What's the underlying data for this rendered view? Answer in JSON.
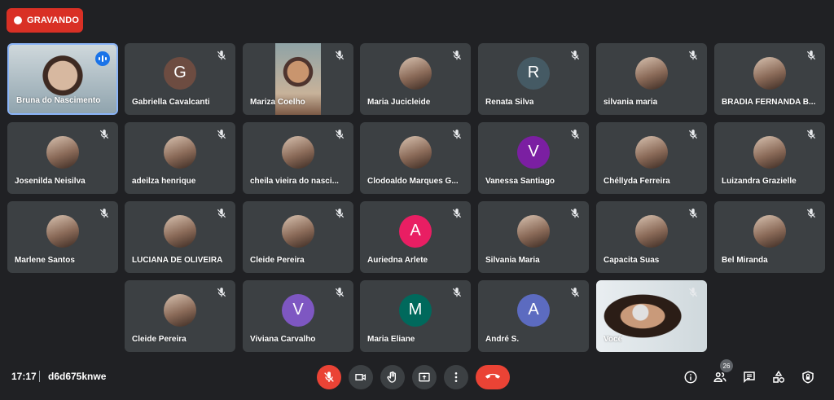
{
  "recording": {
    "label": "GRAVANDO"
  },
  "participants": [
    {
      "name": "Bruna do Nascimento",
      "kind": "video",
      "speaking": true
    },
    {
      "name": "Gabriella Cavalcanti",
      "kind": "letter",
      "initial": "G",
      "color": "#6d4c41"
    },
    {
      "name": "Mariza Coelho",
      "kind": "video"
    },
    {
      "name": "Maria Jucicleide",
      "kind": "photo"
    },
    {
      "name": "Renata Silva",
      "kind": "letter",
      "initial": "R",
      "color": "#455a64"
    },
    {
      "name": "silvania maria",
      "kind": "photo"
    },
    {
      "name": "BRADIA FERNANDA B...",
      "kind": "photo"
    },
    {
      "name": "Josenilda Neisilva",
      "kind": "photo"
    },
    {
      "name": "adeilza henrique",
      "kind": "photo"
    },
    {
      "name": "cheila vieira do nasci...",
      "kind": "photo"
    },
    {
      "name": "Clodoaldo Marques G...",
      "kind": "photo"
    },
    {
      "name": "Vanessa Santiago",
      "kind": "letter",
      "initial": "V",
      "color": "#7b1fa2"
    },
    {
      "name": "Chéllyda Ferreira",
      "kind": "photo"
    },
    {
      "name": "Luizandra Grazielle",
      "kind": "photo"
    },
    {
      "name": "Marlene Santos",
      "kind": "photo"
    },
    {
      "name": "LUCIANA DE OLIVEIRA",
      "kind": "photo"
    },
    {
      "name": "Cleide Pereira",
      "kind": "photo"
    },
    {
      "name": "Auriedna Arlete",
      "kind": "letter",
      "initial": "A",
      "color": "#e91e63"
    },
    {
      "name": "Silvania Maria",
      "kind": "photo"
    },
    {
      "name": "Capacita Suas",
      "kind": "photo"
    },
    {
      "name": "Bel Miranda",
      "kind": "photo"
    },
    {
      "name": "Cleide Pereira",
      "kind": "photo"
    },
    {
      "name": "Viviana Carvalho",
      "kind": "letter",
      "initial": "V",
      "color": "#7e57c2"
    },
    {
      "name": "Maria Eliane",
      "kind": "letter",
      "initial": "M",
      "color": "#00695c"
    },
    {
      "name": "André S.",
      "kind": "letter",
      "initial": "A",
      "color": "#5c6bc0"
    },
    {
      "name": "Você",
      "kind": "video"
    }
  ],
  "bottom": {
    "time": "17:17",
    "meeting_code": "d6d675knwe",
    "participant_count": "26",
    "controls": [
      "mic-off-icon",
      "camera-icon",
      "raise-hand-icon",
      "present-icon",
      "more-icon",
      "leave-call-icon"
    ],
    "right_controls": [
      "info-icon",
      "people-icon",
      "chat-icon",
      "activities-icon",
      "lock-icon"
    ]
  }
}
